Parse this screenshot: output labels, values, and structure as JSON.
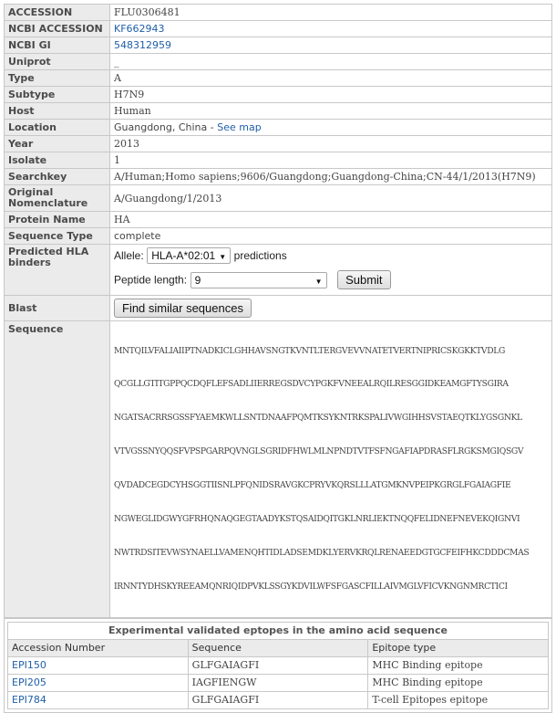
{
  "fields": {
    "accession": {
      "label": "ACCESSION",
      "value": "FLU0306481"
    },
    "ncbi_accession": {
      "label": "NCBI ACCESSION",
      "value": "KF662943"
    },
    "ncbi_gi": {
      "label": "NCBI GI",
      "value": "548312959"
    },
    "uniprot": {
      "label": "Uniprot",
      "value": "_"
    },
    "type": {
      "label": "Type",
      "value": "A"
    },
    "subtype": {
      "label": "Subtype",
      "value": "H7N9"
    },
    "host": {
      "label": "Host",
      "value": "Human"
    },
    "location": {
      "label": "Location",
      "value": "Guangdong, China",
      "sep": " - ",
      "link": "See map"
    },
    "year": {
      "label": "Year",
      "value": "2013"
    },
    "isolate": {
      "label": "Isolate",
      "value": "1"
    },
    "searchkey": {
      "label": "Searchkey",
      "value": "A/Human;Homo sapiens;9606/Guangdong;Guangdong-China;CN-44/1/2013(H7N9)"
    },
    "original_nomenclature": {
      "label": "Original Nomenclature",
      "value": "A/Guangdong/1/2013"
    },
    "protein_name": {
      "label": "Protein Name",
      "value": "HA"
    },
    "sequence_type": {
      "label": "Sequence Type",
      "value": "complete"
    }
  },
  "hla": {
    "label": "Predicted HLA binders",
    "allele_label": "Allele:",
    "allele_value": "HLA-A*02:01",
    "predictions_label": "predictions",
    "peptide_label": "Peptide length:",
    "peptide_value": "9",
    "submit_label": "Submit"
  },
  "blast": {
    "label": "Blast",
    "button_label": "Find similar sequences"
  },
  "sequence": {
    "label": "Sequence",
    "lines": [
      "MNTQILVFALIAIIPTNADKICLGHHAVSNGTKVNTLTERGVEVVNATETVERTNIPRICSKGKKTVDLG",
      "QCGLLGTITGPPQCDQFLEFSADLIIERREGSDVCYPGKFVNEEALRQILRESGGIDKEAMGFTYSGIRA",
      "NGATSACRRSGSSFYAEMKWLLSNTDNAAFPQMTKSYKNTRKSPALIVWGIHHSVSTAEQTKLYGSGNKL",
      "VTVGSSNYQQSFVPSPGARPQVNGLSGRIDFHWLMLNPNDTVTFSFNGAFIAPDRASFLRGKSMGIQSGV",
      "QVDADCEGDCYHSGGTIISNLPFQNIDSRAVGKCPRYVKQRSLLLATGMKNVPEIPKGRGLFGAIAGFIE",
      "NGWEGLIDGWYGFRHQNAQGEGTAADYKSTQSAIDQITGKLNRLIEKTNQQFELIDNEFNEVEKQIGNVI",
      "NWTRDSITEVWSYNAELLVAMENQHTIDLADSEMDKLYERVKRQLRENAEEDGTGCFEIFHKCDDDCMAS",
      "IRNNTYDHSKYREEAMQNRIQIDPVKLSSGYKDVILWFSFGASCFILLAIVMGLVFICVKNGNMRCTICI"
    ]
  },
  "epitopes": {
    "caption": "Experimental validated eptopes in the amino acid sequence",
    "headers": [
      "Accession Number",
      "Sequence",
      "Epitope type"
    ],
    "rows": [
      {
        "acc": "EPI150",
        "seq": "GLFGAIAGFI",
        "type": "MHC Binding epitope"
      },
      {
        "acc": "EPI205",
        "seq": "IAGFIENGW",
        "type": "MHC Binding epitope"
      },
      {
        "acc": "EPI784",
        "seq": "GLFGAIAGFI",
        "type": "T-cell Epitopes epitope"
      }
    ]
  },
  "colors": {
    "link": "#1f5fa8",
    "label_bg": "#ebebeb",
    "border": "#c8c8c8"
  }
}
